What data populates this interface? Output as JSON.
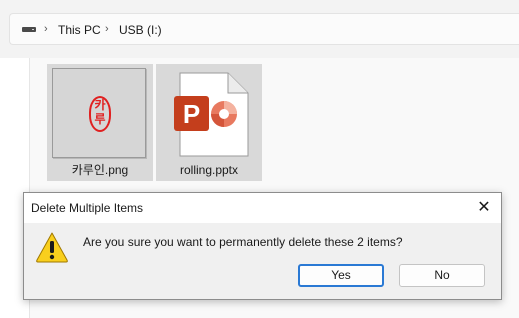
{
  "address_bar": {
    "drive_icon": "usb-drive-icon",
    "separator": "›",
    "crumbs": [
      "This PC",
      "USB (I:)"
    ]
  },
  "files": [
    {
      "name": "카루인.png",
      "icon": "png-thumbnail",
      "seal_chars": [
        "카",
        "루"
      ]
    },
    {
      "name": "rolling.pptx",
      "icon": "powerpoint-file-icon"
    }
  ],
  "dialog": {
    "title": "Delete Multiple Items",
    "close_glyph": "✕",
    "icon": "warning-icon",
    "message": "Are you sure you want to permanently delete these 2 items?",
    "yes_label": "Yes",
    "no_label": "No"
  },
  "colors": {
    "powerpoint_orange": "#c43e1c",
    "powerpoint_light": "#e8795f",
    "seal_red": "#e02020",
    "focus_blue": "#2a79d4",
    "warning_yellow": "#f9cf1d"
  }
}
